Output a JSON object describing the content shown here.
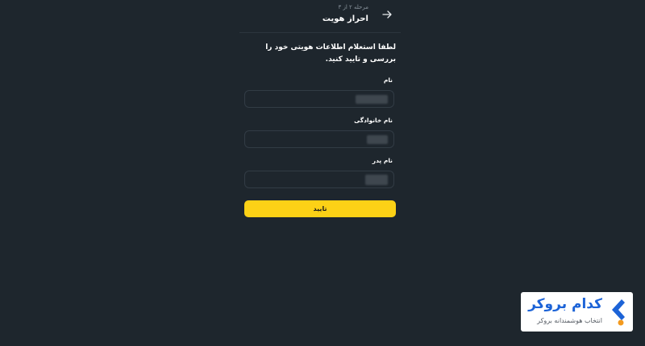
{
  "header": {
    "step": "مرحله ۲ از ۳",
    "title": "احراز هویت",
    "back_icon": "arrow-right-icon"
  },
  "instructions": "لطفا استعلام اطلاعات هویتی خود را بررسی و تایید کنید.",
  "form": {
    "fields": [
      {
        "label": "نام"
      },
      {
        "label": "نام خانوادگی"
      },
      {
        "label": "نام پدر"
      }
    ],
    "submit_label": "تایید"
  },
  "brand": {
    "name": "کدام بروکر",
    "tagline": "انتخاب هوشمندانه بروکر",
    "logo_icon": "chevron-left-logo-icon"
  },
  "colors": {
    "background": "#1e262d",
    "accent": "#fcd116",
    "brand_blue": "#1c63d7",
    "brand_orange": "#f39a1e"
  }
}
